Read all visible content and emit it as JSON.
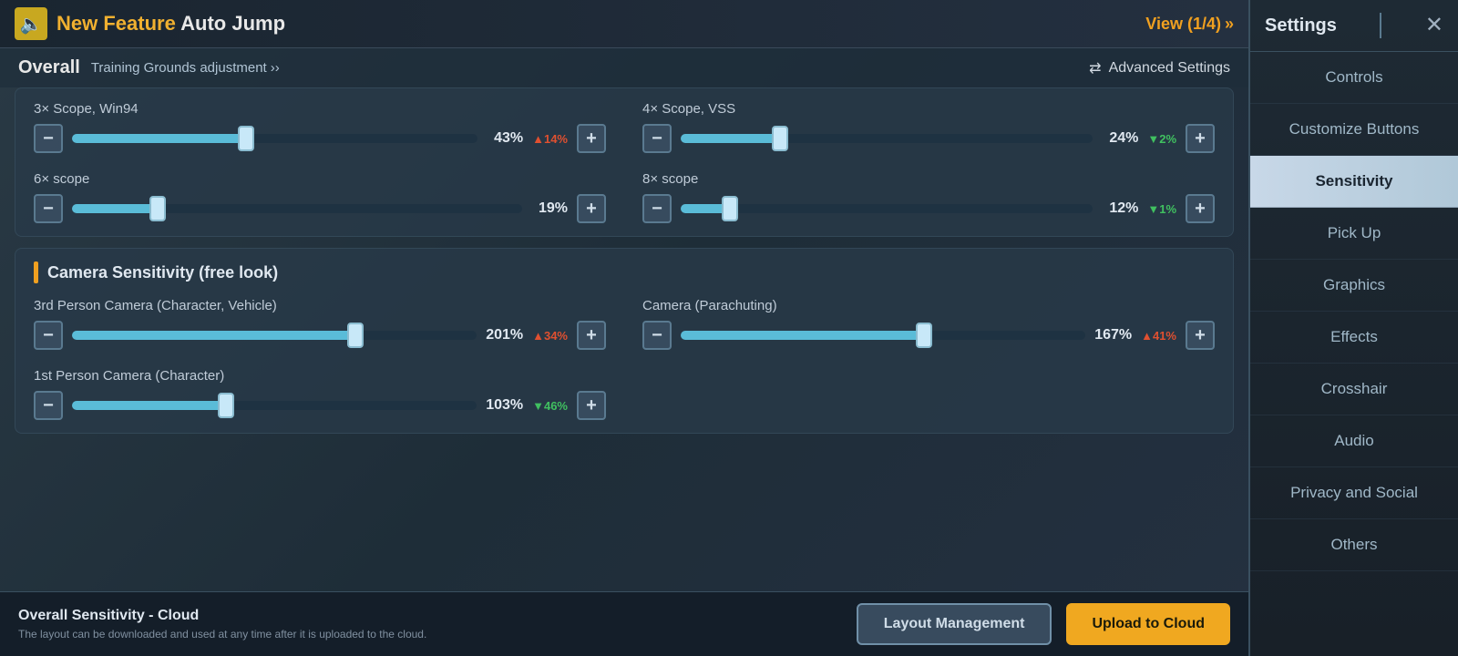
{
  "banner": {
    "new_feature_label": "New Feature",
    "title": "Auto Jump",
    "view_link": "View (1/4)"
  },
  "header": {
    "overall_label": "Overall",
    "training_grounds_label": "Training Grounds adjustment",
    "advanced_settings_label": "Advanced Settings"
  },
  "scope_section": {
    "sliders": [
      {
        "id": "scope3x",
        "label": "3× Scope, Win94",
        "value": "43%",
        "change": "14%",
        "change_dir": "up",
        "fill_pct": 43,
        "thumb_pct": 43
      },
      {
        "id": "scope4x",
        "label": "4× Scope, VSS",
        "value": "24%",
        "change": "2%",
        "change_dir": "down",
        "fill_pct": 24,
        "thumb_pct": 24
      },
      {
        "id": "scope6x",
        "label": "6× scope",
        "value": "19%",
        "change": null,
        "fill_pct": 19,
        "thumb_pct": 19
      },
      {
        "id": "scope8x",
        "label": "8× scope",
        "value": "12%",
        "change": "1%",
        "change_dir": "down",
        "fill_pct": 12,
        "thumb_pct": 12
      }
    ]
  },
  "camera_section": {
    "title": "Camera Sensitivity (free look)",
    "sliders": [
      {
        "id": "cam3rd",
        "label": "3rd Person Camera (Character, Vehicle)",
        "value": "201%",
        "change": "34%",
        "change_dir": "up",
        "fill_pct": 70,
        "thumb_pct": 70
      },
      {
        "id": "camParachute",
        "label": "Camera (Parachuting)",
        "value": "167%",
        "change": "41%",
        "change_dir": "up",
        "fill_pct": 60,
        "thumb_pct": 60
      },
      {
        "id": "cam1st",
        "label": "1st Person Camera (Character)",
        "value": "103%",
        "change": "46%",
        "change_dir": "down",
        "fill_pct": 38,
        "thumb_pct": 38
      }
    ]
  },
  "bottom": {
    "cloud_title": "Overall Sensitivity - Cloud",
    "cloud_subtitle": "The layout can be downloaded and used at any time after it is uploaded to the cloud.",
    "layout_management_label": "Layout Management",
    "upload_cloud_label": "Upload to Cloud"
  },
  "sidebar": {
    "title": "Settings",
    "nav_items": [
      {
        "id": "controls",
        "label": "Controls",
        "active": false
      },
      {
        "id": "customize",
        "label": "Customize Buttons",
        "active": false
      },
      {
        "id": "sensitivity",
        "label": "Sensitivity",
        "active": true
      },
      {
        "id": "pickup",
        "label": "Pick Up",
        "active": false
      },
      {
        "id": "graphics",
        "label": "Graphics",
        "active": false
      },
      {
        "id": "effects",
        "label": "Effects",
        "active": false
      },
      {
        "id": "crosshair",
        "label": "Crosshair",
        "active": false
      },
      {
        "id": "audio",
        "label": "Audio",
        "active": false
      },
      {
        "id": "privacy",
        "label": "Privacy and Social",
        "active": false
      },
      {
        "id": "others",
        "label": "Others",
        "active": false
      }
    ]
  }
}
